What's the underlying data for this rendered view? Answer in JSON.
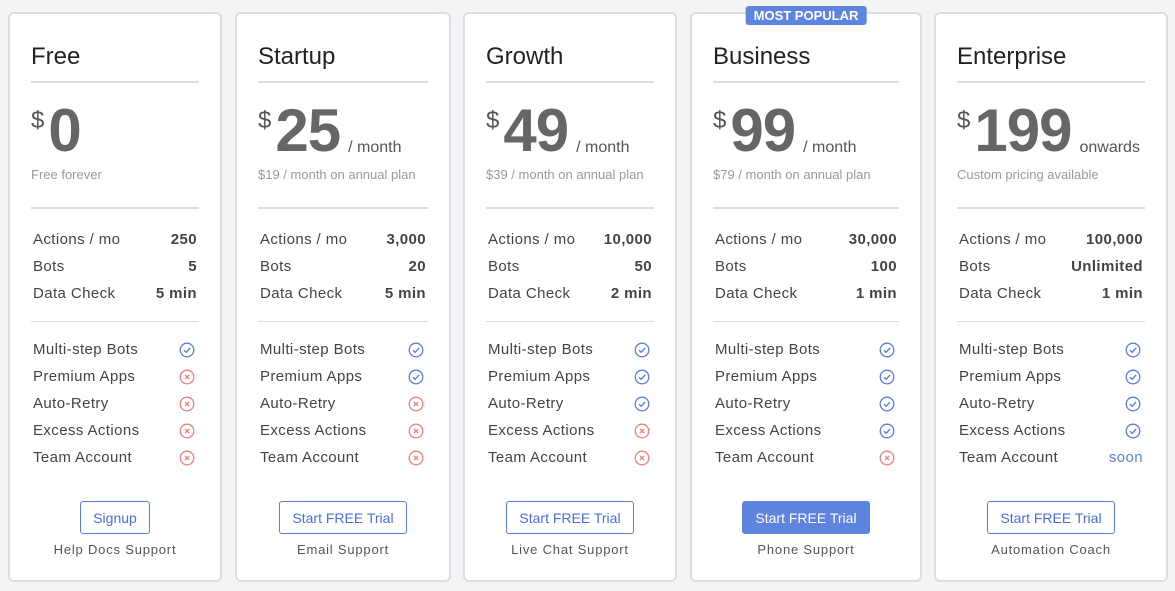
{
  "colors": {
    "accent": "#5e84e0",
    "check": "#5a7fd9",
    "cross": "#f08080"
  },
  "plans": [
    {
      "name": "Free",
      "currency": "$",
      "amount": "0",
      "per": "",
      "subtext": "Free forever",
      "limits": [
        {
          "label": "Actions / mo",
          "value": "250"
        },
        {
          "label": "Bots",
          "value": "5"
        },
        {
          "label": "Data Check",
          "value": "5 min"
        }
      ],
      "features": [
        {
          "label": "Multi-step Bots",
          "status": "check-icon"
        },
        {
          "label": "Premium Apps",
          "status": "cross-icon"
        },
        {
          "label": "Auto-Retry",
          "status": "cross-icon"
        },
        {
          "label": "Excess Actions",
          "status": "cross-icon"
        },
        {
          "label": "Team Account",
          "status": "cross-icon"
        }
      ],
      "button": "Signup",
      "primary": false,
      "support": "Help Docs Support"
    },
    {
      "name": "Startup",
      "currency": "$",
      "amount": "25",
      "per": "/ month",
      "subtext": "$19 / month on annual plan",
      "limits": [
        {
          "label": "Actions / mo",
          "value": "3,000"
        },
        {
          "label": "Bots",
          "value": "20"
        },
        {
          "label": "Data Check",
          "value": "5 min"
        }
      ],
      "features": [
        {
          "label": "Multi-step Bots",
          "status": "check-icon"
        },
        {
          "label": "Premium Apps",
          "status": "check-icon"
        },
        {
          "label": "Auto-Retry",
          "status": "cross-icon"
        },
        {
          "label": "Excess Actions",
          "status": "cross-icon"
        },
        {
          "label": "Team Account",
          "status": "cross-icon"
        }
      ],
      "button": "Start FREE Trial",
      "primary": false,
      "support": "Email Support"
    },
    {
      "name": "Growth",
      "currency": "$",
      "amount": "49",
      "per": "/ month",
      "subtext": "$39 / month on annual plan",
      "limits": [
        {
          "label": "Actions / mo",
          "value": "10,000"
        },
        {
          "label": "Bots",
          "value": "50"
        },
        {
          "label": "Data Check",
          "value": "2 min"
        }
      ],
      "features": [
        {
          "label": "Multi-step Bots",
          "status": "check-icon"
        },
        {
          "label": "Premium Apps",
          "status": "check-icon"
        },
        {
          "label": "Auto-Retry",
          "status": "check-icon"
        },
        {
          "label": "Excess Actions",
          "status": "cross-icon"
        },
        {
          "label": "Team Account",
          "status": "cross-icon"
        }
      ],
      "button": "Start FREE Trial",
      "primary": false,
      "support": "Live Chat Support"
    },
    {
      "name": "Business",
      "badge": "MOST POPULAR",
      "currency": "$",
      "amount": "99",
      "per": "/ month",
      "subtext": "$79 / month on annual plan",
      "limits": [
        {
          "label": "Actions / mo",
          "value": "30,000"
        },
        {
          "label": "Bots",
          "value": "100"
        },
        {
          "label": "Data Check",
          "value": "1 min"
        }
      ],
      "features": [
        {
          "label": "Multi-step Bots",
          "status": "check-icon"
        },
        {
          "label": "Premium Apps",
          "status": "check-icon"
        },
        {
          "label": "Auto-Retry",
          "status": "check-icon"
        },
        {
          "label": "Excess Actions",
          "status": "check-icon"
        },
        {
          "label": "Team Account",
          "status": "cross-icon"
        }
      ],
      "button": "Start FREE Trial",
      "primary": true,
      "support": "Phone Support"
    },
    {
      "name": "Enterprise",
      "currency": "$",
      "amount": "199",
      "per": "onwards",
      "subtext": "Custom pricing available",
      "limits": [
        {
          "label": "Actions / mo",
          "value": "100,000"
        },
        {
          "label": "Bots",
          "value": "Unlimited"
        },
        {
          "label": "Data Check",
          "value": "1 min"
        }
      ],
      "features": [
        {
          "label": "Multi-step Bots",
          "status": "check-icon"
        },
        {
          "label": "Premium Apps",
          "status": "check-icon"
        },
        {
          "label": "Auto-Retry",
          "status": "check-icon"
        },
        {
          "label": "Excess Actions",
          "status": "check-icon"
        },
        {
          "label": "Team Account",
          "status": "text",
          "text": "soon"
        }
      ],
      "button": "Start FREE Trial",
      "primary": false,
      "support": "Automation Coach"
    }
  ]
}
